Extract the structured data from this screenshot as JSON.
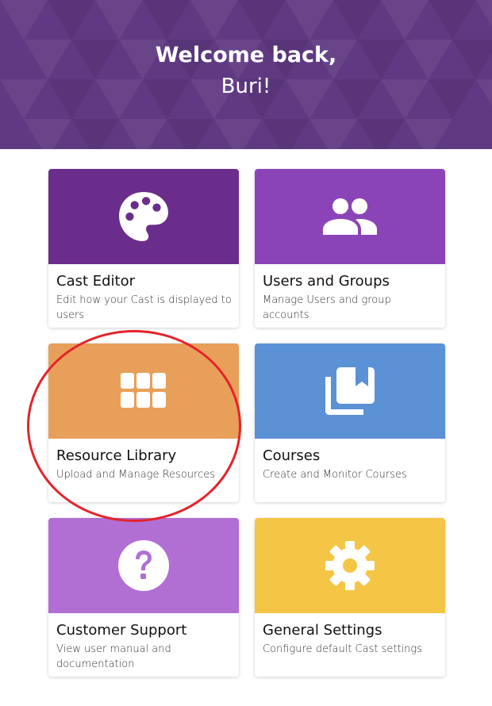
{
  "header": {
    "greeting": "Welcome back,",
    "username": "Buri!"
  },
  "colors": {
    "hero": "#5f3a82",
    "cast_editor": "#6a2d8b",
    "users_groups": "#8b44b8",
    "resource_library": "#e89f5a",
    "courses": "#5b91d5",
    "customer_support": "#b16fd3",
    "general_settings": "#f5c545",
    "highlight_circle": "#e3242b"
  },
  "cards": [
    {
      "title": "Cast Editor",
      "description": "Edit how your Cast is displayed to users",
      "icon": "palette-icon"
    },
    {
      "title": "Users and Groups",
      "description": "Manage Users and group accounts",
      "icon": "users-icon"
    },
    {
      "title": "Resource Library",
      "description": "Upload and Manage Resources",
      "icon": "grid-icon"
    },
    {
      "title": "Courses",
      "description": "Create and Monitor Courses",
      "icon": "book-stack-icon"
    },
    {
      "title": "Customer Support",
      "description": "View user manual and documentation",
      "icon": "question-icon"
    },
    {
      "title": "General Settings",
      "description": "Configure default Cast settings",
      "icon": "gear-icon"
    }
  ]
}
